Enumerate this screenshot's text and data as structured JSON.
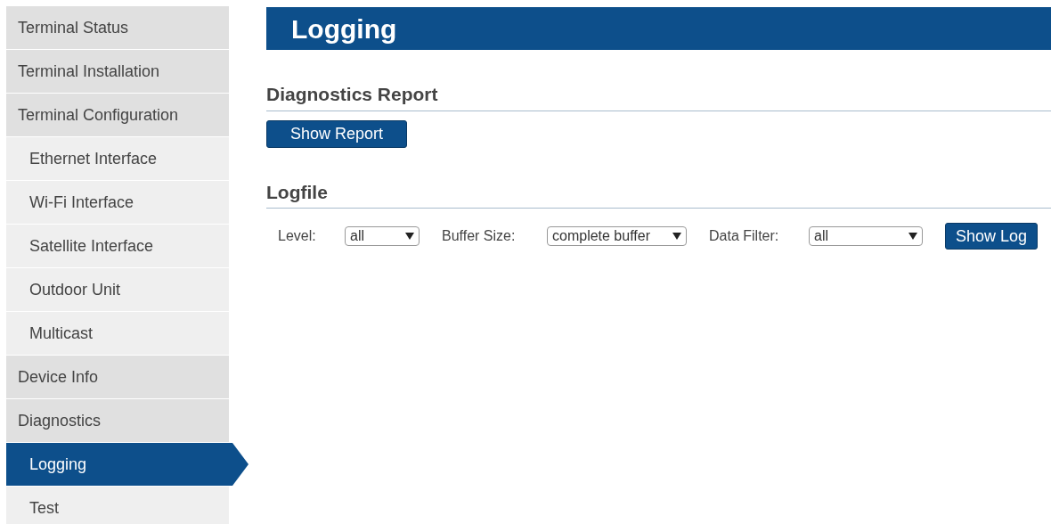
{
  "sidebar": {
    "items": [
      {
        "label": "Terminal Status",
        "selected": false
      },
      {
        "label": "Terminal Installation",
        "selected": false
      },
      {
        "label": "Terminal Configuration",
        "selected": false,
        "children": [
          {
            "label": "Ethernet Interface",
            "selected": false
          },
          {
            "label": "Wi-Fi Interface",
            "selected": false
          },
          {
            "label": "Satellite Interface",
            "selected": false
          },
          {
            "label": "Outdoor Unit",
            "selected": false
          },
          {
            "label": "Multicast",
            "selected": false
          }
        ]
      },
      {
        "label": "Device Info",
        "selected": false
      },
      {
        "label": "Diagnostics",
        "selected": false,
        "children": [
          {
            "label": "Logging",
            "selected": true
          },
          {
            "label": "Test",
            "selected": false
          }
        ]
      }
    ]
  },
  "page": {
    "title": "Logging",
    "sections": [
      {
        "heading": "Diagnostics Report",
        "button": "Show Report"
      },
      {
        "heading": "Logfile",
        "filters": [
          {
            "label": "Level:",
            "value": "all"
          },
          {
            "label": "Buffer Size:",
            "value": "complete buffer"
          },
          {
            "label": "Data Filter:",
            "value": "all"
          }
        ],
        "button": "Show Log"
      }
    ]
  }
}
